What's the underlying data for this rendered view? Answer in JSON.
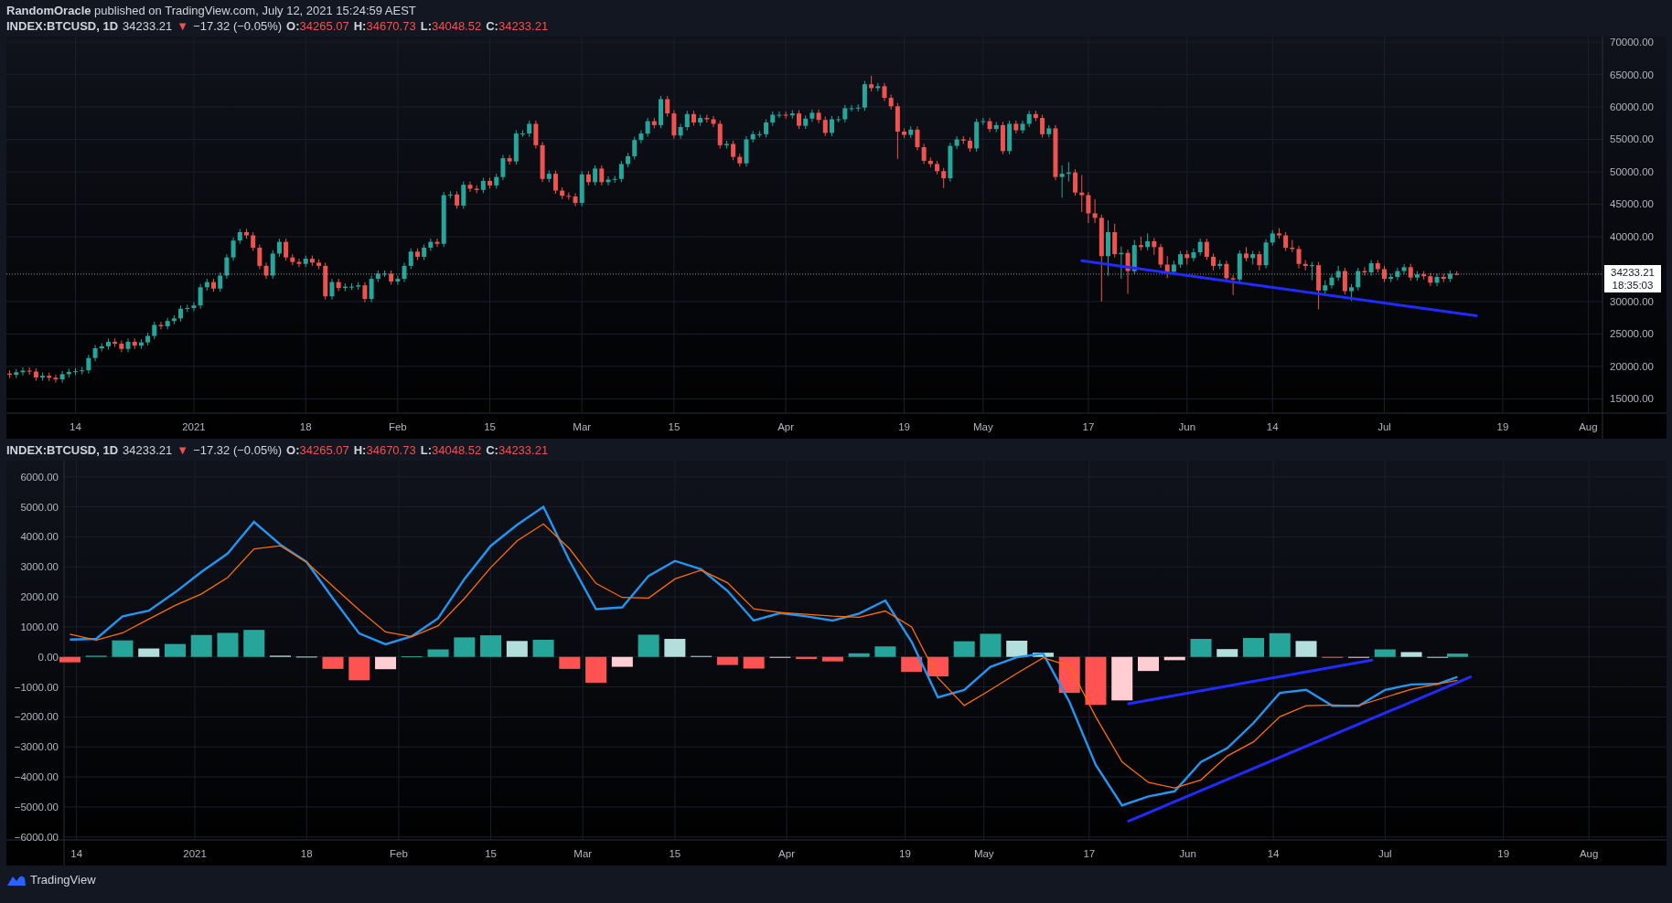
{
  "publish_line": {
    "author": "RandomOracle",
    "text": "published on TradingView.com, July 12, 2021 15:24:59 AEST"
  },
  "price_legend": {
    "symbol": "INDEX:BTCUSD, 1D",
    "price": "34233.21",
    "arrow": "▼",
    "change": "−17.32 (−0.05%)",
    "ohlc": [
      {
        "label": "O:",
        "value": "34265.07"
      },
      {
        "label": "H:",
        "value": "34670.73"
      },
      {
        "label": "L:",
        "value": "34048.52"
      },
      {
        "label": "C:",
        "value": "34233.21"
      }
    ]
  },
  "price_chart": {
    "last_price": "34233.21",
    "countdown": "18:35:03",
    "chart_data": {
      "type": "candlestick",
      "grid": true,
      "xlim": [
        "2020-12-04",
        "2021-08-12"
      ],
      "ylim": [
        12800,
        70850
      ],
      "x": [
        "2020-12-04",
        "2020-12-05",
        "2020-12-06",
        "2020-12-07",
        "2020-12-08",
        "2020-12-09",
        "2020-12-10",
        "2020-12-11",
        "2020-12-12",
        "2020-12-13",
        "2020-12-14",
        "2020-12-15",
        "2020-12-16",
        "2020-12-17",
        "2020-12-18",
        "2020-12-19",
        "2020-12-20",
        "2020-12-21",
        "2020-12-22",
        "2020-12-23",
        "2020-12-24",
        "2020-12-25",
        "2020-12-26",
        "2020-12-27",
        "2020-12-28",
        "2020-12-29",
        "2020-12-30",
        "2020-12-31",
        "2021-01-01",
        "2021-01-02",
        "2021-01-03",
        "2021-01-04",
        "2021-01-05",
        "2021-01-06",
        "2021-01-07",
        "2021-01-08",
        "2021-01-09",
        "2021-01-10",
        "2021-01-11",
        "2021-01-12",
        "2021-01-13",
        "2021-01-14",
        "2021-01-15",
        "2021-01-16",
        "2021-01-17",
        "2021-01-18",
        "2021-01-19",
        "2021-01-20",
        "2021-01-21",
        "2021-01-22",
        "2021-01-23",
        "2021-01-24",
        "2021-01-25",
        "2021-01-26",
        "2021-01-27",
        "2021-01-28",
        "2021-01-29",
        "2021-01-30",
        "2021-01-31",
        "2021-02-01",
        "2021-02-02",
        "2021-02-03",
        "2021-02-04",
        "2021-02-05",
        "2021-02-06",
        "2021-02-07",
        "2021-02-08",
        "2021-02-09",
        "2021-02-10",
        "2021-02-11",
        "2021-02-12",
        "2021-02-13",
        "2021-02-14",
        "2021-02-15",
        "2021-02-16",
        "2021-02-17",
        "2021-02-18",
        "2021-02-19",
        "2021-02-20",
        "2021-02-21",
        "2021-02-22",
        "2021-02-23",
        "2021-02-24",
        "2021-02-25",
        "2021-02-26",
        "2021-02-27",
        "2021-02-28",
        "2021-03-01",
        "2021-03-02",
        "2021-03-03",
        "2021-03-04",
        "2021-03-05",
        "2021-03-06",
        "2021-03-07",
        "2021-03-08",
        "2021-03-09",
        "2021-03-10",
        "2021-03-11",
        "2021-03-12",
        "2021-03-13",
        "2021-03-14",
        "2021-03-15",
        "2021-03-16",
        "2021-03-17",
        "2021-03-18",
        "2021-03-19",
        "2021-03-20",
        "2021-03-21",
        "2021-03-22",
        "2021-03-23",
        "2021-03-24",
        "2021-03-25",
        "2021-03-26",
        "2021-03-27",
        "2021-03-28",
        "2021-03-29",
        "2021-03-30",
        "2021-03-31",
        "2021-04-01",
        "2021-04-02",
        "2021-04-03",
        "2021-04-04",
        "2021-04-05",
        "2021-04-06",
        "2021-04-07",
        "2021-04-08",
        "2021-04-09",
        "2021-04-10",
        "2021-04-11",
        "2021-04-12",
        "2021-04-13",
        "2021-04-14",
        "2021-04-15",
        "2021-04-16",
        "2021-04-17",
        "2021-04-18",
        "2021-04-19",
        "2021-04-20",
        "2021-04-21",
        "2021-04-22",
        "2021-04-23",
        "2021-04-24",
        "2021-04-25",
        "2021-04-26",
        "2021-04-27",
        "2021-04-28",
        "2021-04-29",
        "2021-04-30",
        "2021-05-01",
        "2021-05-02",
        "2021-05-03",
        "2021-05-04",
        "2021-05-05",
        "2021-05-06",
        "2021-05-07",
        "2021-05-08",
        "2021-05-09",
        "2021-05-10",
        "2021-05-11",
        "2021-05-12",
        "2021-05-13",
        "2021-05-14",
        "2021-05-15",
        "2021-05-16",
        "2021-05-17",
        "2021-05-18",
        "2021-05-19",
        "2021-05-20",
        "2021-05-21",
        "2021-05-22",
        "2021-05-23",
        "2021-05-24",
        "2021-05-25",
        "2021-05-26",
        "2021-05-27",
        "2021-05-28",
        "2021-05-29",
        "2021-05-30",
        "2021-05-31",
        "2021-06-01",
        "2021-06-02",
        "2021-06-03",
        "2021-06-04",
        "2021-06-05",
        "2021-06-06",
        "2021-06-07",
        "2021-06-08",
        "2021-06-09",
        "2021-06-10",
        "2021-06-11",
        "2021-06-12",
        "2021-06-13",
        "2021-06-14",
        "2021-06-15",
        "2021-06-16",
        "2021-06-17",
        "2021-06-18",
        "2021-06-19",
        "2021-06-20",
        "2021-06-21",
        "2021-06-22",
        "2021-06-23",
        "2021-06-24",
        "2021-06-25",
        "2021-06-26",
        "2021-06-27",
        "2021-06-28",
        "2021-06-29",
        "2021-06-30",
        "2021-07-01",
        "2021-07-02",
        "2021-07-03",
        "2021-07-04",
        "2021-07-05",
        "2021-07-06",
        "2021-07-07",
        "2021-07-08",
        "2021-07-09",
        "2021-07-10",
        "2021-07-11",
        "2021-07-12"
      ],
      "xticks": [
        {
          "value": "2020-12-14",
          "label": "14"
        },
        {
          "value": "2021-01-01",
          "label": "2021"
        },
        {
          "value": "2021-01-18",
          "label": "18"
        },
        {
          "value": "2021-02-01",
          "label": "Feb"
        },
        {
          "value": "2021-02-15",
          "label": "15"
        },
        {
          "value": "2021-03-01",
          "label": "Mar"
        },
        {
          "value": "2021-03-15",
          "label": "15"
        },
        {
          "value": "2021-04-01",
          "label": "Apr"
        },
        {
          "value": "2021-04-19",
          "label": "19"
        },
        {
          "value": "2021-05-01",
          "label": "May"
        },
        {
          "value": "2021-05-17",
          "label": "17"
        },
        {
          "value": "2021-06-01",
          "label": "Jun"
        },
        {
          "value": "2021-06-14",
          "label": "14"
        },
        {
          "value": "2021-07-01",
          "label": "Jul"
        },
        {
          "value": "2021-07-19",
          "label": "19"
        },
        {
          "value": "2021-08-01",
          "label": "Aug"
        }
      ],
      "yticks": [
        {
          "value": 70000,
          "label": "70000.00"
        },
        {
          "value": 65000,
          "label": "65000.00"
        },
        {
          "value": 60000,
          "label": "60000.00"
        },
        {
          "value": 55000,
          "label": "55000.00"
        },
        {
          "value": 50000,
          "label": "50000.00"
        },
        {
          "value": 45000,
          "label": "45000.00"
        },
        {
          "value": 40000,
          "label": "40000.00"
        },
        {
          "value": 30000,
          "label": "30000.00"
        },
        {
          "value": 25000,
          "label": "25000.00"
        },
        {
          "value": 20000,
          "label": "20000.00"
        },
        {
          "value": 15000,
          "label": "15000.00"
        }
      ],
      "ohlc": [
        [
          18900,
          19400,
          18200,
          18700
        ],
        [
          18700,
          19600,
          18200,
          19100
        ],
        [
          19100,
          19850,
          18600,
          19350
        ],
        [
          19350,
          19850,
          18700,
          19200
        ],
        [
          19200,
          19700,
          17800,
          18300
        ],
        [
          18300,
          19050,
          17800,
          18550
        ],
        [
          18550,
          19050,
          17750,
          18250
        ],
        [
          18250,
          18750,
          17500,
          18000
        ],
        [
          18000,
          19300,
          17500,
          18800
        ],
        [
          18800,
          19650,
          18300,
          19150
        ],
        [
          19150,
          19750,
          18650,
          19250
        ],
        [
          19250,
          19900,
          18750,
          19400
        ],
        [
          19400,
          21800,
          18900,
          21300
        ],
        [
          21300,
          23300,
          20800,
          22800
        ],
        [
          22800,
          23600,
          22300,
          23100
        ],
        [
          23100,
          24300,
          22600,
          23800
        ],
        [
          23800,
          24300,
          23000,
          23500
        ],
        [
          23500,
          24000,
          22200,
          22700
        ],
        [
          22700,
          24300,
          22200,
          23800
        ],
        [
          23800,
          24300,
          22700,
          23200
        ],
        [
          23200,
          24200,
          22700,
          23700
        ],
        [
          23700,
          25200,
          23200,
          24700
        ],
        [
          24700,
          26900,
          24200,
          26400
        ],
        [
          26400,
          26900,
          25700,
          26200
        ],
        [
          26200,
          27500,
          25700,
          27000
        ],
        [
          27000,
          27900,
          26500,
          27400
        ],
        [
          27400,
          29400,
          26900,
          28900
        ],
        [
          28900,
          29500,
          28400,
          29000
        ],
        [
          29000,
          29900,
          28500,
          29400
        ],
        [
          29400,
          32700,
          28900,
          32200
        ],
        [
          32200,
          33500,
          31700,
          33000
        ],
        [
          33000,
          33500,
          31500,
          32000
        ],
        [
          32000,
          34500,
          31500,
          34000
        ],
        [
          34000,
          37300,
          33500,
          36800
        ],
        [
          36800,
          39900,
          36300,
          39400
        ],
        [
          39400,
          41200,
          38900,
          40700
        ],
        [
          40700,
          41200,
          39700,
          40200
        ],
        [
          40200,
          40700,
          37800,
          38300
        ],
        [
          38300,
          38800,
          35000,
          35500
        ],
        [
          35500,
          36000,
          33500,
          34000
        ],
        [
          34000,
          37900,
          33500,
          37400
        ],
        [
          37400,
          39700,
          36900,
          39200
        ],
        [
          39200,
          39700,
          36300,
          36800
        ],
        [
          36800,
          37300,
          35600,
          36100
        ],
        [
          36100,
          36600,
          35300,
          35800
        ],
        [
          35800,
          37100,
          35300,
          36600
        ],
        [
          36600,
          37100,
          35500,
          36000
        ],
        [
          36000,
          36500,
          35000,
          35500
        ],
        [
          35500,
          36000,
          30300,
          30800
        ],
        [
          30800,
          33500,
          30300,
          33000
        ],
        [
          33000,
          33500,
          31600,
          32100
        ],
        [
          32100,
          32800,
          31600,
          32300
        ],
        [
          32300,
          32800,
          31800,
          32300
        ],
        [
          32300,
          33000,
          31800,
          32500
        ],
        [
          32500,
          33000,
          29900,
          30400
        ],
        [
          30400,
          34000,
          29900,
          33500
        ],
        [
          33500,
          34800,
          33000,
          34300
        ],
        [
          34300,
          34800,
          33800,
          34300
        ],
        [
          34300,
          34800,
          32600,
          33100
        ],
        [
          33100,
          34000,
          32600,
          33500
        ],
        [
          33500,
          36000,
          33000,
          35500
        ],
        [
          35500,
          38200,
          35000,
          37700
        ],
        [
          37700,
          38200,
          36400,
          36900
        ],
        [
          36900,
          38800,
          36400,
          38300
        ],
        [
          38300,
          39700,
          37800,
          39200
        ],
        [
          39200,
          39700,
          38400,
          38900
        ],
        [
          38900,
          46900,
          38400,
          46400
        ],
        [
          46400,
          47000,
          45900,
          46500
        ],
        [
          46500,
          47000,
          44300,
          44800
        ],
        [
          44800,
          48500,
          44300,
          48000
        ],
        [
          48000,
          48500,
          46900,
          47400
        ],
        [
          47400,
          47900,
          46700,
          47200
        ],
        [
          47200,
          49100,
          46700,
          48600
        ],
        [
          48600,
          49100,
          47400,
          47900
        ],
        [
          47900,
          49700,
          47400,
          49200
        ],
        [
          49200,
          52600,
          48700,
          52100
        ],
        [
          52100,
          52600,
          51100,
          51600
        ],
        [
          51600,
          56400,
          51100,
          55900
        ],
        [
          55900,
          56400,
          55400,
          55900
        ],
        [
          55900,
          57900,
          55400,
          57400
        ],
        [
          57400,
          57900,
          53600,
          54100
        ],
        [
          54100,
          54600,
          48400,
          48900
        ],
        [
          48900,
          50200,
          48400,
          49700
        ],
        [
          49700,
          50200,
          46600,
          47100
        ],
        [
          47100,
          47600,
          45800,
          46300
        ],
        [
          46300,
          46800,
          45700,
          46200
        ],
        [
          46200,
          46700,
          44700,
          45200
        ],
        [
          45200,
          50100,
          44700,
          49600
        ],
        [
          49600,
          50100,
          47900,
          48400
        ],
        [
          48400,
          51000,
          47900,
          50500
        ],
        [
          50500,
          51000,
          47900,
          48400
        ],
        [
          48400,
          49300,
          47900,
          48800
        ],
        [
          48800,
          49400,
          48300,
          48900
        ],
        [
          48900,
          51700,
          48400,
          51200
        ],
        [
          51200,
          52900,
          50700,
          52400
        ],
        [
          52400,
          55400,
          51900,
          54900
        ],
        [
          54900,
          56400,
          54400,
          55900
        ],
        [
          55900,
          58300,
          55400,
          57800
        ],
        [
          57800,
          58300,
          56700,
          57200
        ],
        [
          57200,
          61700,
          56700,
          61200
        ],
        [
          61200,
          61700,
          58500,
          59000
        ],
        [
          59000,
          59500,
          55100,
          55600
        ],
        [
          55600,
          57400,
          55100,
          56900
        ],
        [
          56900,
          59400,
          56400,
          58900
        ],
        [
          58900,
          59400,
          57100,
          57600
        ],
        [
          57600,
          58800,
          57100,
          58300
        ],
        [
          58300,
          58800,
          57600,
          58100
        ],
        [
          58100,
          58600,
          56900,
          57400
        ],
        [
          57400,
          57900,
          53600,
          54100
        ],
        [
          54100,
          54800,
          53600,
          54300
        ],
        [
          54300,
          54800,
          51800,
          52300
        ],
        [
          52300,
          52800,
          50800,
          51300
        ],
        [
          51300,
          55500,
          50800,
          55000
        ],
        [
          55000,
          56300,
          54500,
          55800
        ],
        [
          55800,
          56300,
          55300,
          55800
        ],
        [
          55800,
          58100,
          55300,
          57600
        ],
        [
          57600,
          59300,
          57100,
          58800
        ],
        [
          58800,
          59300,
          58300,
          58800
        ],
        [
          58800,
          59300,
          58200,
          58700
        ],
        [
          58700,
          59500,
          58200,
          59000
        ],
        [
          59000,
          59500,
          56600,
          57100
        ],
        [
          57100,
          58700,
          56600,
          58200
        ],
        [
          58200,
          59600,
          57700,
          59100
        ],
        [
          59100,
          59600,
          57500,
          58000
        ],
        [
          58000,
          58500,
          55500,
          56000
        ],
        [
          56000,
          58600,
          55500,
          58100
        ],
        [
          58100,
          58600,
          57600,
          58100
        ],
        [
          58100,
          60300,
          57600,
          59800
        ],
        [
          59800,
          60300,
          59300,
          59800
        ],
        [
          59800,
          60400,
          59300,
          59900
        ],
        [
          59900,
          64000,
          59400,
          63500
        ],
        [
          63500,
          64800,
          62400,
          62900
        ],
        [
          62900,
          63700,
          62400,
          63200
        ],
        [
          63200,
          63700,
          60900,
          61400
        ],
        [
          61400,
          61900,
          59600,
          60100
        ],
        [
          60100,
          60600,
          52000,
          56200
        ],
        [
          56200,
          56700,
          55200,
          55700
        ],
        [
          55700,
          57000,
          55200,
          56500
        ],
        [
          56500,
          57000,
          53300,
          53800
        ],
        [
          53800,
          54300,
          51200,
          51700
        ],
        [
          51700,
          52200,
          50700,
          51200
        ],
        [
          51200,
          51700,
          49600,
          50100
        ],
        [
          50100,
          50600,
          47500,
          49000
        ],
        [
          49000,
          54500,
          48500,
          54000
        ],
        [
          54000,
          55500,
          53500,
          55000
        ],
        [
          55000,
          55500,
          54300,
          54800
        ],
        [
          54800,
          55300,
          53100,
          53600
        ],
        [
          53600,
          58200,
          53100,
          57700
        ],
        [
          57700,
          58300,
          57200,
          57800
        ],
        [
          57800,
          58300,
          56100,
          56600
        ],
        [
          56600,
          57700,
          56100,
          57200
        ],
        [
          57200,
          57700,
          52700,
          53200
        ],
        [
          53200,
          57900,
          52700,
          57400
        ],
        [
          57400,
          57900,
          55900,
          56400
        ],
        [
          56400,
          57900,
          55900,
          57400
        ],
        [
          57400,
          59400,
          56900,
          58900
        ],
        [
          58900,
          59400,
          57800,
          58300
        ],
        [
          58300,
          58800,
          55300,
          55800
        ],
        [
          55800,
          57200,
          55300,
          56700
        ],
        [
          56700,
          57200,
          48700,
          49200
        ],
        [
          49200,
          51000,
          46000,
          49700
        ],
        [
          49700,
          51500,
          48500,
          49900
        ],
        [
          49900,
          50400,
          46300,
          46800
        ],
        [
          46800,
          49500,
          43800,
          46400
        ],
        [
          46400,
          46900,
          42100,
          43600
        ],
        [
          43600,
          45800,
          42100,
          42900
        ],
        [
          42900,
          43400,
          30000,
          37000
        ],
        [
          37000,
          42500,
          34000,
          40700
        ],
        [
          40700,
          42000,
          36800,
          37300
        ],
        [
          37300,
          38500,
          33500,
          37500
        ],
        [
          37500,
          38000,
          31200,
          34700
        ],
        [
          34700,
          39500,
          34200,
          38700
        ],
        [
          38700,
          40000,
          37900,
          38400
        ],
        [
          38400,
          40500,
          37900,
          39300
        ],
        [
          39300,
          39800,
          37200,
          38400
        ],
        [
          38400,
          38900,
          35200,
          35700
        ],
        [
          35700,
          37000,
          33600,
          34600
        ],
        [
          34600,
          36300,
          34100,
          35700
        ],
        [
          35700,
          37800,
          35200,
          37300
        ],
        [
          37300,
          37900,
          35700,
          36700
        ],
        [
          36700,
          38200,
          36200,
          37600
        ],
        [
          37600,
          39700,
          37100,
          39200
        ],
        [
          39200,
          39700,
          36400,
          36900
        ],
        [
          36900,
          37400,
          34800,
          35500
        ],
        [
          35500,
          36400,
          35000,
          35800
        ],
        [
          35800,
          36300,
          33100,
          33600
        ],
        [
          33600,
          34100,
          31000,
          33400
        ],
        [
          33400,
          37900,
          32900,
          37400
        ],
        [
          37400,
          38400,
          36200,
          36700
        ],
        [
          36700,
          37800,
          35700,
          37300
        ],
        [
          37300,
          37800,
          34800,
          35600
        ],
        [
          35600,
          39600,
          35100,
          39100
        ],
        [
          39100,
          41000,
          38600,
          40500
        ],
        [
          40500,
          41300,
          39700,
          40200
        ],
        [
          40200,
          40700,
          37800,
          38300
        ],
        [
          38300,
          39500,
          37600,
          38100
        ],
        [
          38100,
          38600,
          35100,
          35800
        ],
        [
          35800,
          36400,
          34800,
          35500
        ],
        [
          35500,
          36100,
          33300,
          35600
        ],
        [
          35600,
          36100,
          28800,
          31700
        ],
        [
          31700,
          33300,
          31200,
          32500
        ],
        [
          32500,
          34200,
          32000,
          33700
        ],
        [
          33700,
          35500,
          33200,
          34700
        ],
        [
          34700,
          35200,
          31100,
          31600
        ],
        [
          31600,
          32700,
          30100,
          32200
        ],
        [
          32200,
          35200,
          31700,
          34700
        ],
        [
          34700,
          35300,
          34000,
          34500
        ],
        [
          34500,
          36400,
          34000,
          35900
        ],
        [
          35900,
          36400,
          34500,
          35000
        ],
        [
          35000,
          35500,
          33000,
          33500
        ],
        [
          33500,
          34300,
          33000,
          33800
        ],
        [
          33800,
          35200,
          33300,
          34700
        ],
        [
          34700,
          35800,
          34200,
          35300
        ],
        [
          35300,
          35800,
          33200,
          33700
        ],
        [
          33700,
          34700,
          33200,
          34200
        ],
        [
          34200,
          34700,
          33400,
          33900
        ],
        [
          33900,
          34400,
          32400,
          32900
        ],
        [
          32900,
          34300,
          32400,
          33800
        ],
        [
          33800,
          34300,
          33000,
          33500
        ],
        [
          33500,
          34800,
          33000,
          34300
        ],
        [
          34265,
          34671,
          34049,
          34233
        ]
      ]
    }
  },
  "macd_legend": {
    "symbol": "INDEX:BTCUSD, 1D",
    "price": "34233.21",
    "arrow": "▼",
    "change": "−17.32 (−0.05%)",
    "ohlc": [
      {
        "label": "O:",
        "value": "34265.07"
      },
      {
        "label": "H:",
        "value": "34670.73"
      },
      {
        "label": "L:",
        "value": "34048.52"
      },
      {
        "label": "C:",
        "value": "34233.21"
      }
    ]
  },
  "macd_chart": {
    "chart_data": {
      "type": "line",
      "grid": true,
      "xlim": [
        "2020-12-03",
        "2021-08-12"
      ],
      "ylim": [
        -6100,
        6540
      ],
      "x": [
        "2020-12-13",
        "2020-12-17",
        "2020-12-21",
        "2020-12-25",
        "2020-12-29",
        "2021-01-02",
        "2021-01-06",
        "2021-01-10",
        "2021-01-14",
        "2021-01-18",
        "2021-01-22",
        "2021-01-26",
        "2021-01-30",
        "2021-02-03",
        "2021-02-07",
        "2021-02-11",
        "2021-02-15",
        "2021-02-19",
        "2021-02-23",
        "2021-02-27",
        "2021-03-03",
        "2021-03-07",
        "2021-03-11",
        "2021-03-15",
        "2021-03-19",
        "2021-03-23",
        "2021-03-27",
        "2021-03-31",
        "2021-04-04",
        "2021-04-08",
        "2021-04-12",
        "2021-04-16",
        "2021-04-20",
        "2021-04-24",
        "2021-04-28",
        "2021-05-02",
        "2021-05-06",
        "2021-05-10",
        "2021-05-14",
        "2021-05-18",
        "2021-05-22",
        "2021-05-26",
        "2021-05-30",
        "2021-06-03",
        "2021-06-07",
        "2021-06-11",
        "2021-06-15",
        "2021-06-19",
        "2021-06-23",
        "2021-06-27",
        "2021-07-01",
        "2021-07-05",
        "2021-07-09",
        "2021-07-12"
      ],
      "xticks": [
        {
          "value": "2020-12-14",
          "label": "14"
        },
        {
          "value": "2021-01-01",
          "label": "2021"
        },
        {
          "value": "2021-01-18",
          "label": "18"
        },
        {
          "value": "2021-02-01",
          "label": "Feb"
        },
        {
          "value": "2021-02-15",
          "label": "15"
        },
        {
          "value": "2021-03-01",
          "label": "Mar"
        },
        {
          "value": "2021-03-15",
          "label": "15"
        },
        {
          "value": "2021-04-01",
          "label": "Apr"
        },
        {
          "value": "2021-04-19",
          "label": "19"
        },
        {
          "value": "2021-05-01",
          "label": "May"
        },
        {
          "value": "2021-05-17",
          "label": "17"
        },
        {
          "value": "2021-06-01",
          "label": "Jun"
        },
        {
          "value": "2021-06-14",
          "label": "14"
        },
        {
          "value": "2021-07-01",
          "label": "Jul"
        },
        {
          "value": "2021-07-19",
          "label": "19"
        },
        {
          "value": "2021-08-01",
          "label": "Aug"
        }
      ],
      "yticks": [
        {
          "value": 6000,
          "label": "6000.00"
        },
        {
          "value": 5000,
          "label": "5000.00"
        },
        {
          "value": 4000,
          "label": "4000.00"
        },
        {
          "value": 3000,
          "label": "3000.00"
        },
        {
          "value": 2000,
          "label": "2000.00"
        },
        {
          "value": 1000,
          "label": "1000.00"
        },
        {
          "value": 0,
          "label": "0.00"
        },
        {
          "value": -1000,
          "label": "−1000.00"
        },
        {
          "value": -2000,
          "label": "−2000.00"
        },
        {
          "value": -3000,
          "label": "−3000.00"
        },
        {
          "value": -4000,
          "label": "−4000.00"
        },
        {
          "value": -5000,
          "label": "−5000.00"
        },
        {
          "value": -6000,
          "label": "−6000.00"
        }
      ],
      "series": [
        {
          "type": "line",
          "color": "#2196f3",
          "values": [
            580,
            600,
            1350,
            1540,
            2150,
            2830,
            3450,
            4500,
            3740,
            3160,
            1950,
            780,
            420,
            690,
            1290,
            2600,
            3700,
            4400,
            5000,
            3200,
            1590,
            1650,
            2700,
            3200,
            2920,
            2200,
            1210,
            1460,
            1350,
            1210,
            1440,
            1880,
            500,
            -1350,
            -1100,
            -330,
            -10,
            110,
            -1500,
            -3600,
            -4950,
            -4650,
            -4480,
            -3500,
            -3040,
            -2200,
            -1200,
            -1100,
            -1630,
            -1630,
            -1100,
            -920,
            -900,
            -670
          ]
        },
        {
          "type": "line",
          "color": "#ff6d00",
          "values": [
            760,
            560,
            800,
            1260,
            1720,
            2100,
            2650,
            3600,
            3700,
            3150,
            2350,
            1560,
            830,
            670,
            1040,
            1950,
            2980,
            3870,
            4430,
            3600,
            2450,
            1980,
            1960,
            2600,
            2890,
            2470,
            1600,
            1480,
            1420,
            1360,
            1320,
            1530,
            1000,
            -700,
            -1620,
            -1100,
            -550,
            -30,
            -300,
            -2000,
            -3500,
            -4180,
            -4370,
            -4100,
            -3300,
            -2830,
            -1990,
            -1630,
            -1600,
            -1620,
            -1350,
            -1080,
            -900,
            -780
          ]
        },
        {
          "type": "bar",
          "colors": [
            "#ff5252",
            "#26a69a",
            "#26a69a",
            "#b2dfdb",
            "#26a69a",
            "#26a69a",
            "#26a69a",
            "#26a69a",
            "#b2dfdb",
            "#b2dfdb",
            "#ff5252",
            "#ff5252",
            "#ffcdd2",
            "#26a69a",
            "#26a69a",
            "#26a69a",
            "#26a69a",
            "#b2dfdb",
            "#26a69a",
            "#ff5252",
            "#ff5252",
            "#ffcdd2",
            "#26a69a",
            "#b2dfdb",
            "#b2dfdb",
            "#ff5252",
            "#ff5252",
            "#ffcdd2",
            "#ff5252",
            "#ff5252",
            "#26a69a",
            "#26a69a",
            "#ff5252",
            "#ff5252",
            "#26a69a",
            "#26a69a",
            "#b2dfdb",
            "#b2dfdb",
            "#ff5252",
            "#ff5252",
            "#ffcdd2",
            "#ffcdd2",
            "#ffcdd2",
            "#26a69a",
            "#b2dfdb",
            "#26a69a",
            "#26a69a",
            "#b2dfdb",
            "#ff5252",
            "#ffcdd2",
            "#26a69a",
            "#b2dfdb",
            "#b2dfdb",
            "#26a69a"
          ],
          "values": [
            -180,
            40,
            550,
            280,
            430,
            730,
            800,
            900,
            40,
            10,
            -400,
            -780,
            -410,
            20,
            250,
            650,
            720,
            530,
            570,
            -400,
            -860,
            -330,
            740,
            600,
            30,
            -270,
            -390,
            -20,
            -70,
            -150,
            120,
            350,
            -500,
            -650,
            520,
            770,
            540,
            140,
            -1200,
            -1600,
            -1450,
            -470,
            -110,
            600,
            260,
            630,
            790,
            530,
            -30,
            -10,
            250,
            160,
            0,
            110
          ]
        }
      ]
    }
  },
  "footer": {
    "brand": "TradingView"
  }
}
